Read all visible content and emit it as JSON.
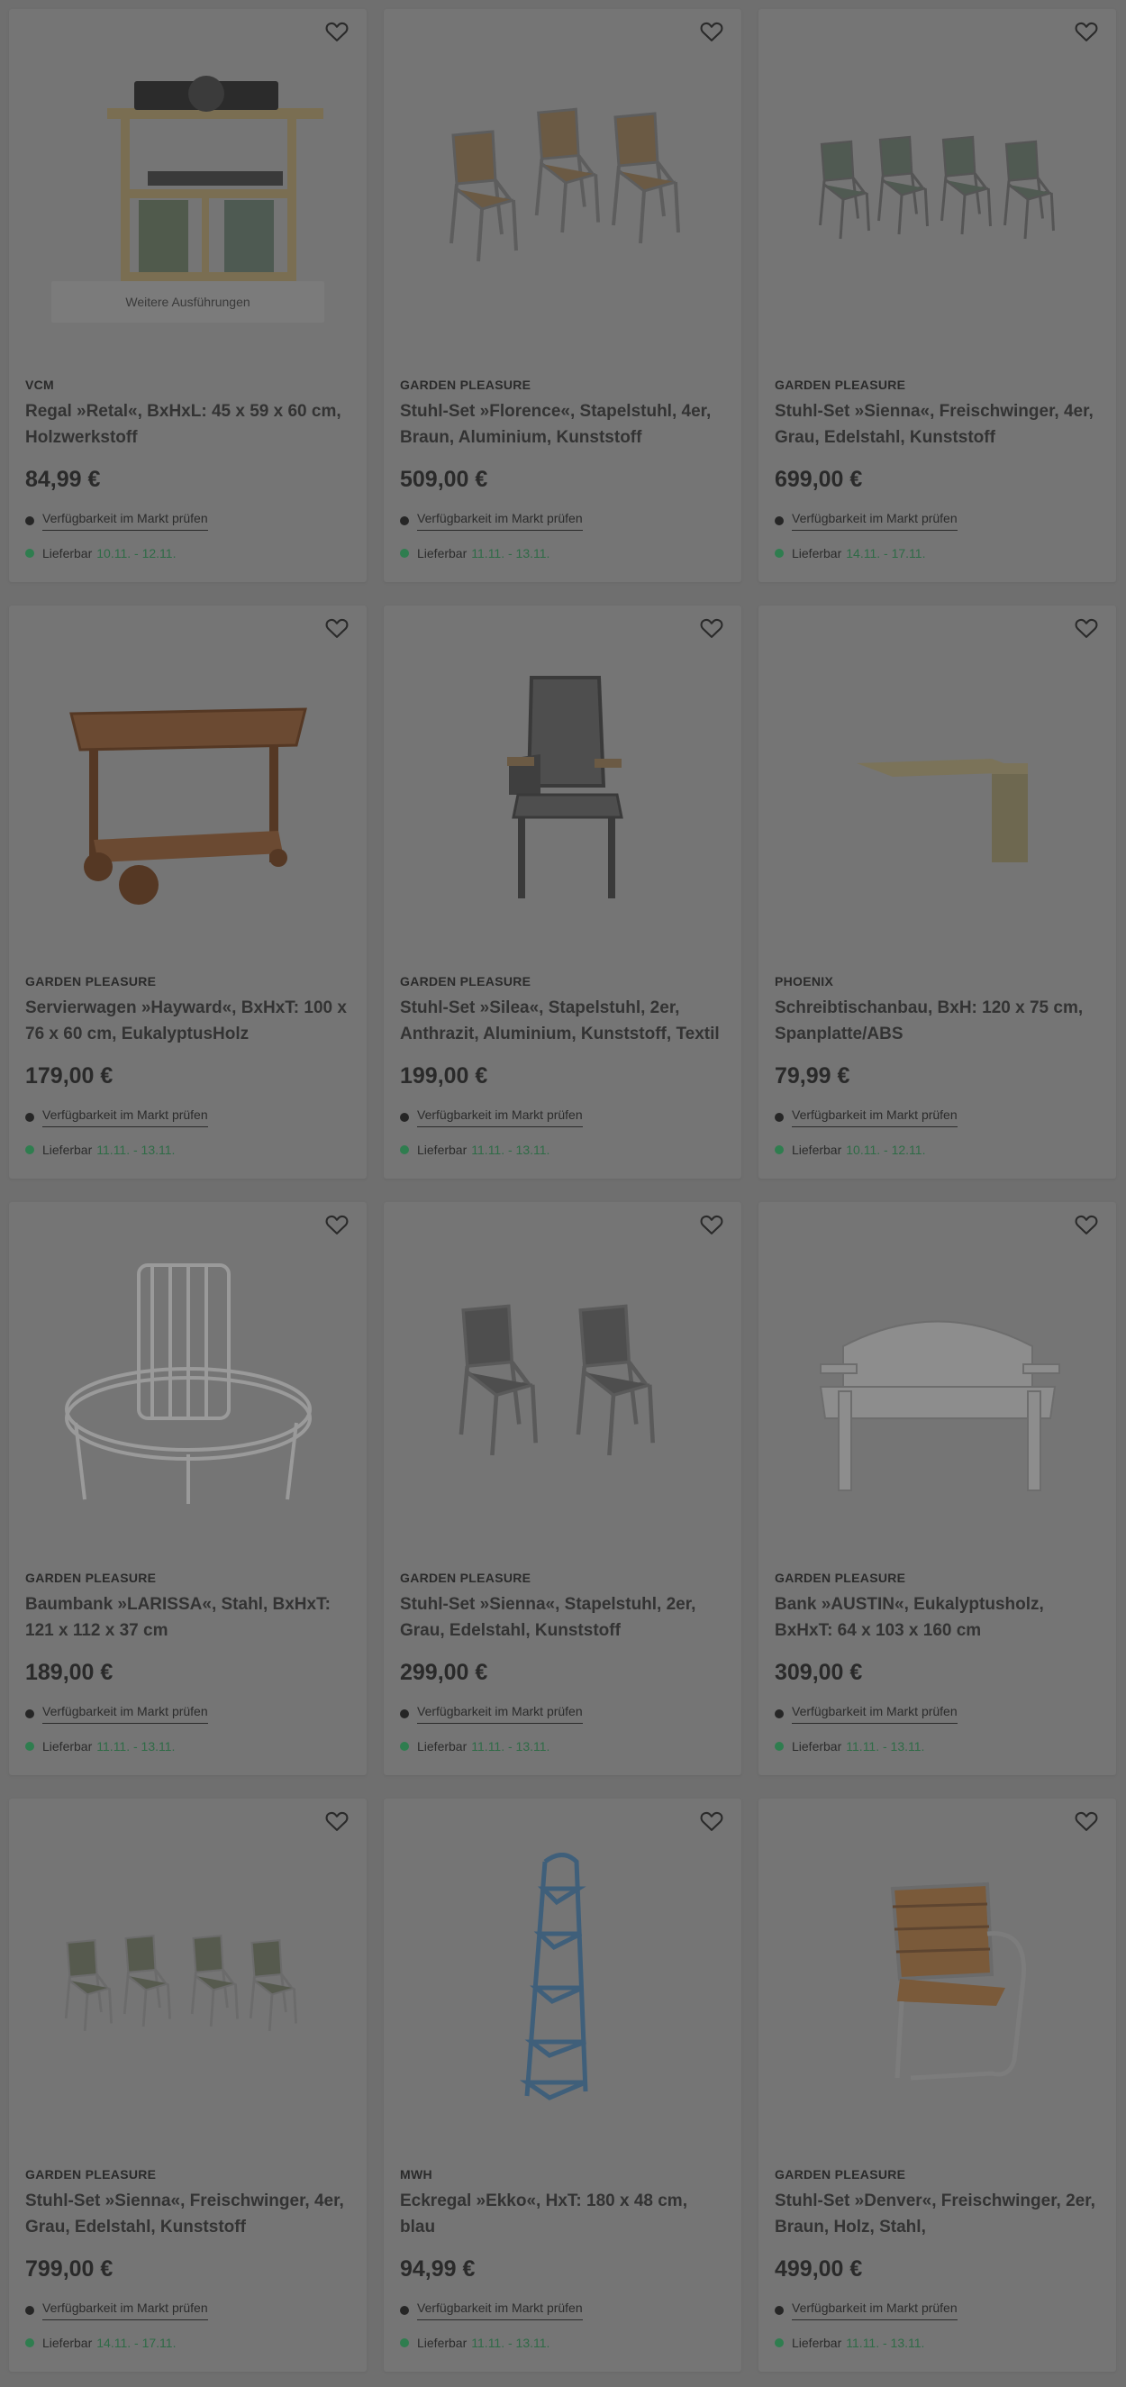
{
  "products": [
    {
      "brand": "VCM",
      "title": "Regal »Retal«, BxHxL: 45 x 59 x 60 cm, Holzwerkstoff",
      "price": "84,99 €",
      "availability": "Verfügbarkeit im Markt prüfen",
      "delivery_label": "Lieferbar",
      "delivery_dates": "10.11. - 12.11.",
      "variants": "Weitere Ausführungen",
      "image": "record-shelf-image"
    },
    {
      "brand": "GARDEN PLEASURE",
      "title": "Stuhl-Set »Florence«, Stapelstuhl, 4er, Braun, Aluminium, Kunststoff",
      "price": "509,00 €",
      "availability": "Verfügbarkeit im Markt prüfen",
      "delivery_label": "Lieferbar",
      "delivery_dates": "11.11. - 13.11.",
      "image": "chairs-florence-image"
    },
    {
      "brand": "GARDEN PLEASURE",
      "title": "Stuhl-Set »Sienna«, Freischwinger, 4er, Grau, Edelstahl, Kunststoff",
      "price": "699,00 €",
      "availability": "Verfügbarkeit im Markt prüfen",
      "delivery_label": "Lieferbar",
      "delivery_dates": "14.11. - 17.11.",
      "image": "chairs-sienna-4-image"
    },
    {
      "brand": "GARDEN PLEASURE",
      "title": "Servierwagen »Hayward«, BxHxT: 100 x 76 x 60 cm, EukalyptusHolz",
      "price": "179,00 €",
      "availability": "Verfügbarkeit im Markt prüfen",
      "delivery_label": "Lieferbar",
      "delivery_dates": "11.11. - 13.11.",
      "image": "serving-cart-image"
    },
    {
      "brand": "GARDEN PLEASURE",
      "title": "Stuhl-Set »Silea«, Stapelstuhl, 2er, Anthrazit, Aluminium, Kunststoff, Textil",
      "price": "199,00 €",
      "availability": "Verfügbarkeit im Markt prüfen",
      "delivery_label": "Lieferbar",
      "delivery_dates": "11.11. - 13.11.",
      "image": "chair-silea-image"
    },
    {
      "brand": "PHOENIX",
      "title": "Schreibtischanbau, BxH: 120 x 75 cm, Spanplatte/ABS",
      "price": "79,99 €",
      "availability": "Verfügbarkeit im Markt prüfen",
      "delivery_label": "Lieferbar",
      "delivery_dates": "10.11. - 12.11.",
      "image": "desk-extension-image"
    },
    {
      "brand": "GARDEN PLEASURE",
      "title": "Baumbank »LARISSA«, Stahl, BxHxT: 121 x 112 x 37 cm",
      "price": "189,00 €",
      "availability": "Verfügbarkeit im Markt prüfen",
      "delivery_label": "Lieferbar",
      "delivery_dates": "11.11. - 13.11.",
      "image": "tree-bench-image"
    },
    {
      "brand": "GARDEN PLEASURE",
      "title": "Stuhl-Set »Sienna«, Stapelstuhl, 2er, Grau, Edelstahl, Kunststoff",
      "price": "299,00 €",
      "availability": "Verfügbarkeit im Markt prüfen",
      "delivery_label": "Lieferbar",
      "delivery_dates": "11.11. - 13.11.",
      "image": "chairs-sienna-2-image"
    },
    {
      "brand": "GARDEN PLEASURE",
      "title": "Bank »AUSTIN«, Eukalyptusholz, BxHxT: 64 x 103 x 160 cm",
      "price": "309,00 €",
      "availability": "Verfügbarkeit im Markt prüfen",
      "delivery_label": "Lieferbar",
      "delivery_dates": "11.11. - 13.11.",
      "image": "bench-austin-image"
    },
    {
      "brand": "GARDEN PLEASURE",
      "title": "Stuhl-Set »Sienna«, Freischwinger, 4er, Grau, Edelstahl, Kunststoff",
      "price": "799,00 €",
      "availability": "Verfügbarkeit im Markt prüfen",
      "delivery_label": "Lieferbar",
      "delivery_dates": "14.11. - 17.11.",
      "image": "chairs-sienna-4b-image"
    },
    {
      "brand": "MWH",
      "title": "Eckregal »Ekko«, HxT: 180 x 48 cm, blau",
      "price": "94,99 €",
      "availability": "Verfügbarkeit im Markt prüfen",
      "delivery_label": "Lieferbar",
      "delivery_dates": "11.11. - 13.11.",
      "image": "corner-shelf-image"
    },
    {
      "brand": "GARDEN PLEASURE",
      "title": "Stuhl-Set »Denver«, Freischwinger, 2er, Braun, Holz, Stahl,",
      "price": "499,00 €",
      "availability": "Verfügbarkeit im Markt prüfen",
      "delivery_label": "Lieferbar",
      "delivery_dates": "11.11. - 13.11.",
      "image": "chair-denver-image"
    }
  ],
  "icons": {
    "favorite": "heart-outline-icon",
    "availability_bullet": "dot-icon",
    "delivery_bullet": "green-dot-icon"
  },
  "colors": {
    "overlay": "#6f6f6f",
    "card": "#757575",
    "delivery_dates": "#2e6b46"
  }
}
